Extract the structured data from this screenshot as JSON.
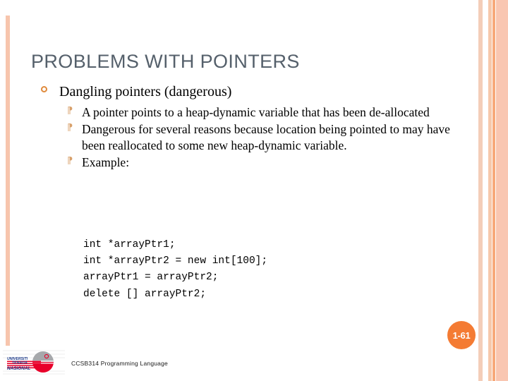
{
  "slide": {
    "title": "PROBLEMS WITH POINTERS",
    "bullets": [
      {
        "level1": "Dangling pointers (dangerous)",
        "sub": [
          "A pointer points to a heap-dynamic variable that has been de-allocated",
          "Dangerous for several reasons because location being pointed to may have been reallocated to some new heap-dynamic variable.",
          "Example:"
        ]
      }
    ],
    "code": "int *arrayPtr1;\nint *arrayPtr2 = new int[100];\narrayPtr1 = arrayPtr2;\ndelete [] arrayPtr2;",
    "slide_number": "1-61",
    "footer_text": "CCSB314 Programming Language",
    "logo": {
      "line1": "UNIVERSITI",
      "line2": "TENAGA",
      "line3": "NASIONAL"
    },
    "bullet_glyphs": {
      "level1": "open-circle",
      "level2": "⁋"
    },
    "colors": {
      "title": "#55606b",
      "accent_orange": "#f47b33",
      "band_salmon": "#f9c6b1",
      "bullet_orange": "#e08a3c",
      "logo_red": "#e8002a",
      "logo_gray": "#a6a8ab"
    }
  }
}
